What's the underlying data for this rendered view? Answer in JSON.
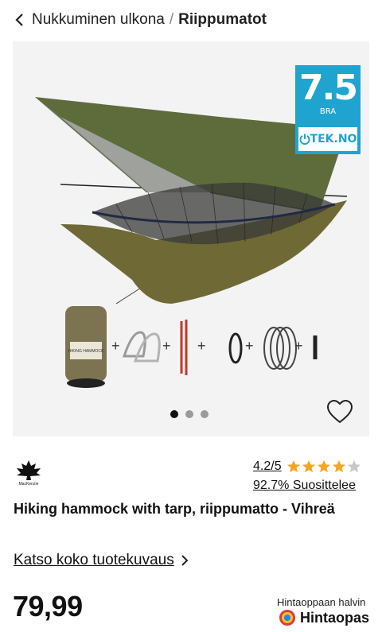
{
  "breadcrumb": {
    "parent": "Nukkuminen ulkona",
    "separator": "/",
    "current": "Riippumatot"
  },
  "gallery": {
    "badge": {
      "score": "7.5",
      "label": "BRA",
      "brand": "TEK.NO"
    },
    "slides": 3,
    "active_slide": 1,
    "package_text": "HIKING HAMMOCK"
  },
  "brand": {
    "logo_text": "MacKenzie"
  },
  "rating": {
    "value": "4.2/5",
    "stars": 4.2,
    "max_stars": 5,
    "recommend": "92.7% Suosittelee"
  },
  "product": {
    "title": "Hiking hammock with tarp, riippumatto - Vihreä",
    "details_link": "Katso koko tuotekuvaus",
    "price": "79,99"
  },
  "price_guide": {
    "hint": "Hintaoppaan halvin",
    "brand": "Hintaopas"
  },
  "colors": {
    "badge": "#1fa4d0",
    "tarp": "#5e6b3b",
    "hammock": "#6f6a35",
    "star": "#f5a623"
  }
}
